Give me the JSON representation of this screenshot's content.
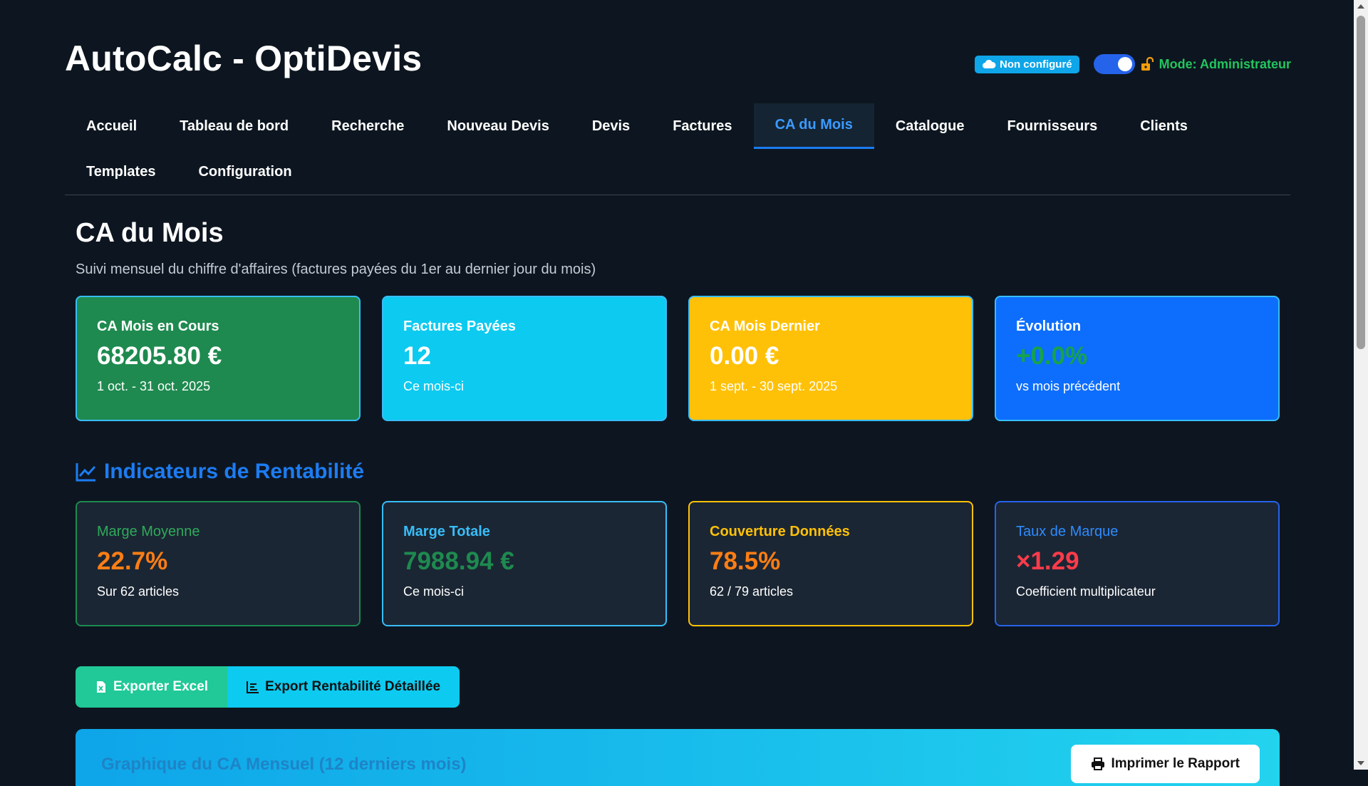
{
  "header": {
    "title": "AutoCalc - OptiDevis",
    "cloud_status": "Non configuré",
    "mode_label": "Mode: Administrateur",
    "admin_toggle_on": true
  },
  "nav": {
    "items": [
      "Accueil",
      "Tableau de bord",
      "Recherche",
      "Nouveau Devis",
      "Devis",
      "Factures",
      "CA du Mois",
      "Catalogue",
      "Fournisseurs",
      "Clients",
      "Templates",
      "Configuration"
    ],
    "active": "CA du Mois"
  },
  "page": {
    "title": "CA du Mois",
    "subtitle": "Suivi mensuel du chiffre d'affaires (factures payées du 1er au dernier jour du mois)"
  },
  "kpi_cards": [
    {
      "title": "CA Mois en Cours",
      "value": "68205.80 €",
      "sub": "1 oct. - 31 oct. 2025",
      "color": "#1e8a4f"
    },
    {
      "title": "Factures Payées",
      "value": "12",
      "sub": "Ce mois-ci",
      "color": "#0dcaf0"
    },
    {
      "title": "CA Mois Dernier",
      "value": "0.00 €",
      "sub": "1 sept. - 30 sept. 2025",
      "color": "#ffc107"
    },
    {
      "title": "Évolution",
      "value": "+0.0%",
      "sub": "vs mois précédent",
      "color": "#0d6efd"
    }
  ],
  "profitability": {
    "section_title": "Indicateurs de Rentabilité",
    "section_icon": "line-chart-icon",
    "cards": [
      {
        "title": "Marge Moyenne",
        "value": "22.7%",
        "sub": "Sur 62 articles"
      },
      {
        "title": "Marge Totale",
        "value": "7988.94 €",
        "sub": "Ce mois-ci"
      },
      {
        "title": "Couverture Données",
        "value": "78.5%",
        "sub": "62 / 79 articles"
      },
      {
        "title": "Taux de Marque",
        "value": "×1.29",
        "sub": "Coefficient multiplicateur"
      }
    ]
  },
  "actions": {
    "export_excel": "Exporter Excel",
    "export_detailed": "Export Rentabilité Détaillée"
  },
  "report": {
    "title": "Graphique du CA Mensuel (12 derniers mois)",
    "print_label": "Imprimer le Rapport"
  },
  "colors": {
    "background": "#0d1620",
    "accent": "#1d7cf2",
    "admin_green": "#22c55e"
  }
}
